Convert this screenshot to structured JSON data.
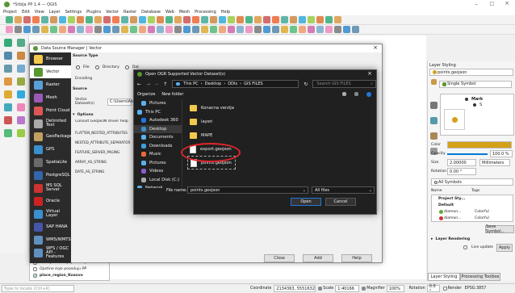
{
  "qgis": {
    "window_title": "*Srbija PP 1.4 — QGIS",
    "menu": [
      "Project",
      "Edit",
      "View",
      "Layer",
      "Settings",
      "Plugins",
      "Vector",
      "Raster",
      "Database",
      "Web",
      "Mesh",
      "Processing",
      "Help"
    ],
    "layer_styling_title": "Layer Styling",
    "layer_name": "points.geojson",
    "renderer": "Single Symbol",
    "symbol_items": [
      "Mark",
      "S"
    ],
    "color_label": "Color",
    "opacity_label": "Opacity",
    "opacity_value": "100.0 %",
    "size_label": "Size",
    "size_value": "2.00000",
    "size_unit": "Millimeters",
    "rotation_label": "Rotation",
    "rotation_value": "0.00 °",
    "symbol_search": "All Symbols",
    "col_name": "Name",
    "col_tags": "Tags",
    "symbols": [
      {
        "name": "Project Sty...",
        "tags": ""
      },
      {
        "name": "Default",
        "tags": ""
      },
      {
        "name": "diamon...",
        "tags": "Colorful"
      },
      {
        "name": "diamon...",
        "tags": "Colorful"
      }
    ],
    "save_symbol": "Save Symbol...",
    "layer_rendering": "Layer Rendering",
    "live_update": "Live update",
    "apply": "Apply",
    "bottom_tabs": [
      "Layer Styling",
      "Processing Toolbox"
    ],
    "layers_tree": [
      "Sve opstine koje poseduju PP u Srb",
      "Opstine koje poseduju PP",
      "place_region_Kosovo"
    ],
    "locate_placeholder": "Type to locate (Ctrl+K)",
    "status": {
      "coordinate_label": "Coordinate",
      "coordinate_value": "2134363, 5551632",
      "scale_label": "Scale",
      "scale_value": "1:40166",
      "magnifier_label": "Magnifier",
      "magnifier_value": "100%",
      "rotation_label": "Rotation",
      "rotation_value": "0.0 °",
      "render_label": "Render",
      "crs": "EPSG:3857"
    }
  },
  "dsm": {
    "title": "Data Source Manager | Vector",
    "sidebar": [
      "Browser",
      "Vector",
      "Raster",
      "Mesh",
      "Point Cloud",
      "Delimited Text",
      "GeoPackage",
      "GPS",
      "SpatiaLite",
      "PostgreSQL",
      "MS SQL Server",
      "Oracle",
      "Virtual Layer",
      "SAP HANA",
      "WMS/WMTS",
      "WFS / OGC API - Features"
    ],
    "source_type_label": "Source Type",
    "radio_file": "File",
    "radio_directory": "Directory",
    "radio_db": "Dat",
    "encoding_label": "Encoding",
    "source_label": "Source",
    "vector_dataset_label": "Vector Dataset(s)",
    "vector_dataset_value": "C:\\Users\\Alex",
    "options_label": "Options",
    "consult_text": "Consult GeoJSON driver help page",
    "options": [
      "FLATTEN_NESTED_ATTRIBUTES",
      "NESTED_ATTRIBUTE_SEPARATOR",
      "FEATURE_SERVER_PAGING",
      "ARRAY_AS_STRING",
      "DATE_AS_STRING"
    ],
    "btn_close": "Close",
    "btn_add": "Add",
    "btn_help": "Help"
  },
  "ogr": {
    "title": "Open OGR Supported Vector Dataset(s)",
    "path": [
      "This PC",
      "Desktop",
      "ODIs",
      "GIS FILES"
    ],
    "search_placeholder": "Search GIS FILES",
    "organize": "Organize",
    "new_folder": "New folder",
    "nav": [
      "Pictures",
      "This PC",
      "Autodesk 360",
      "Desktop",
      "Documents",
      "Downloads",
      "Music",
      "Pictures",
      "Videos",
      "Local Disk (C:)",
      "Network"
    ],
    "files": [
      {
        "name": "Konacna verzija",
        "kind": "folder"
      },
      {
        "name": "layeri",
        "kind": "folder"
      },
      {
        "name": "MAPE",
        "kind": "folder"
      },
      {
        "name": "export.geojson",
        "kind": "file"
      },
      {
        "name": "points.geojson",
        "kind": "file"
      }
    ],
    "file_name_label": "File name:",
    "file_name_value": "points.geojson",
    "filter_value": "All files",
    "btn_open": "Open",
    "btn_cancel": "Cancel"
  },
  "colors": {
    "qgis_green": "#589632",
    "sidebar_bg": "#2b2b2b",
    "highlight": "#0078d7",
    "annotation_red": "#e0262a"
  }
}
